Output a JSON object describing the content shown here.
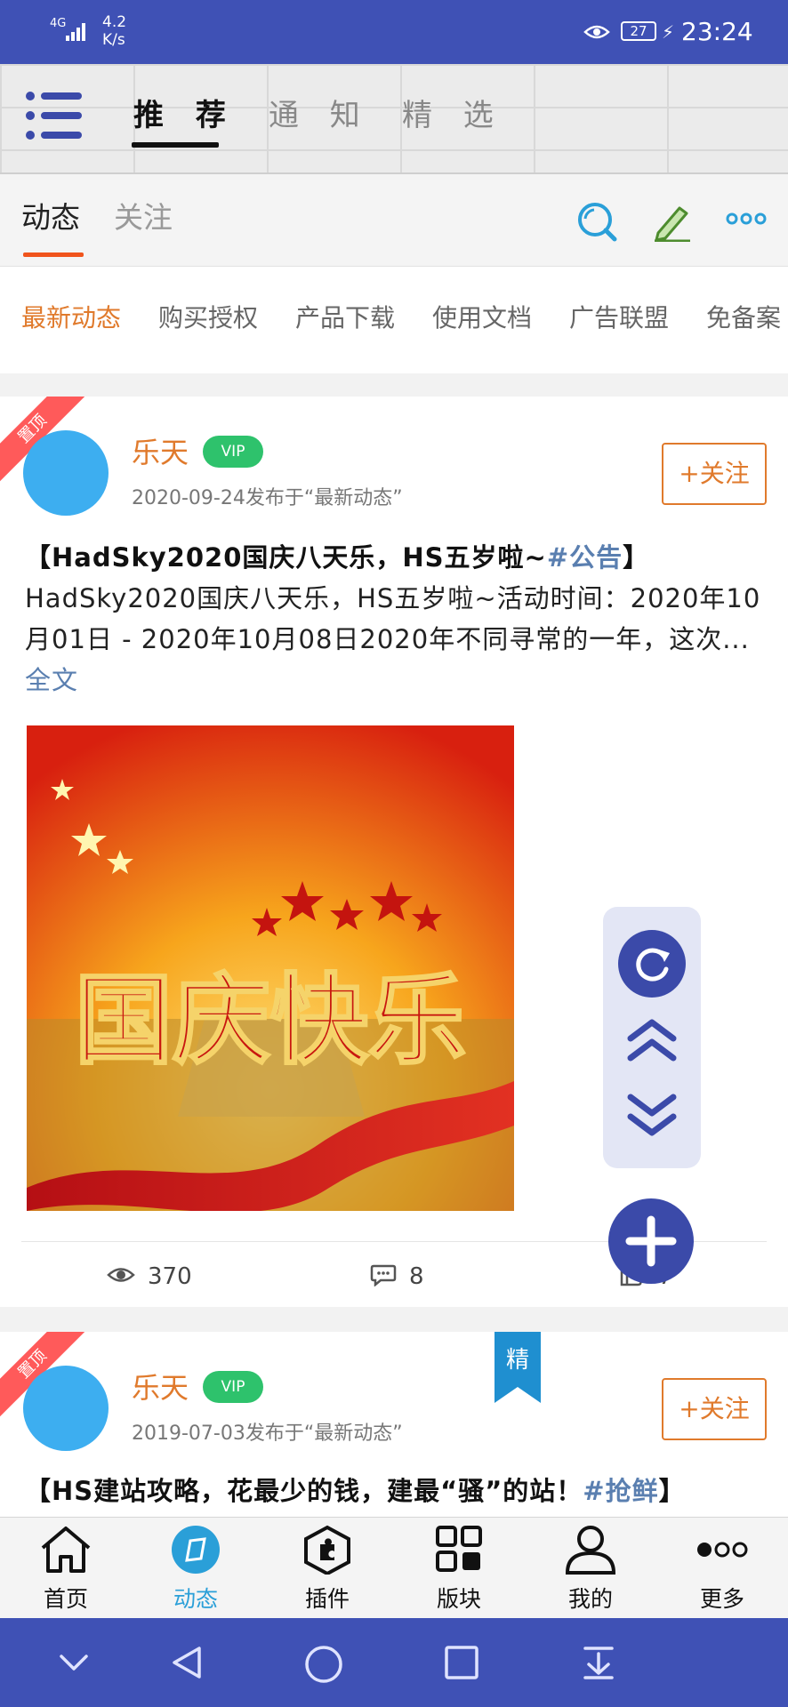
{
  "status_bar": {
    "network": "4G",
    "speed_value": "4.2",
    "speed_unit": "K/s",
    "battery": "27",
    "time": "23:24"
  },
  "top_tabs": [
    "推 荐",
    "通 知",
    "精 选"
  ],
  "sub_tabs": {
    "active": "动态",
    "other": "关注"
  },
  "categories": [
    "最新动态",
    "购买授权",
    "产品下载",
    "使用文档",
    "广告联盟",
    "免备案"
  ],
  "posts": [
    {
      "ribbon": "置顶",
      "author": "乐天",
      "vip": "VIP",
      "meta": "2020-09-24发布于“最新动态”",
      "follow": "+关注",
      "title_bold": "【HadSky2020国庆八天乐，HS五岁啦~",
      "tag": "#公告",
      "title_end": "】",
      "body": "HadSky2020国庆八天乐，HS五岁啦~活动时间：2020年10月01日 - 2020年10月08日2020年不同寻常的一年，这次...",
      "more": "全文",
      "image_text": "国庆快乐",
      "views": "370",
      "comments": "8",
      "likes": "7"
    },
    {
      "ribbon": "置顶",
      "badge": "精",
      "author": "乐天",
      "vip": "VIP",
      "meta": "2019-07-03发布于“最新动态”",
      "follow": "+关注",
      "title_bold": "【HS建站攻略，花最少的钱，建最“骚”的站！",
      "tag": "#抢鲜",
      "title_end": "】"
    }
  ],
  "bottom_nav": [
    "首页",
    "动态",
    "插件",
    "版块",
    "我的",
    "更多"
  ],
  "colors": {
    "primary": "#3f51b5",
    "accent": "#e07a2c",
    "vip": "#2ec26c",
    "avatar": "#3daef0",
    "ribbon": "#ff5a5a"
  }
}
